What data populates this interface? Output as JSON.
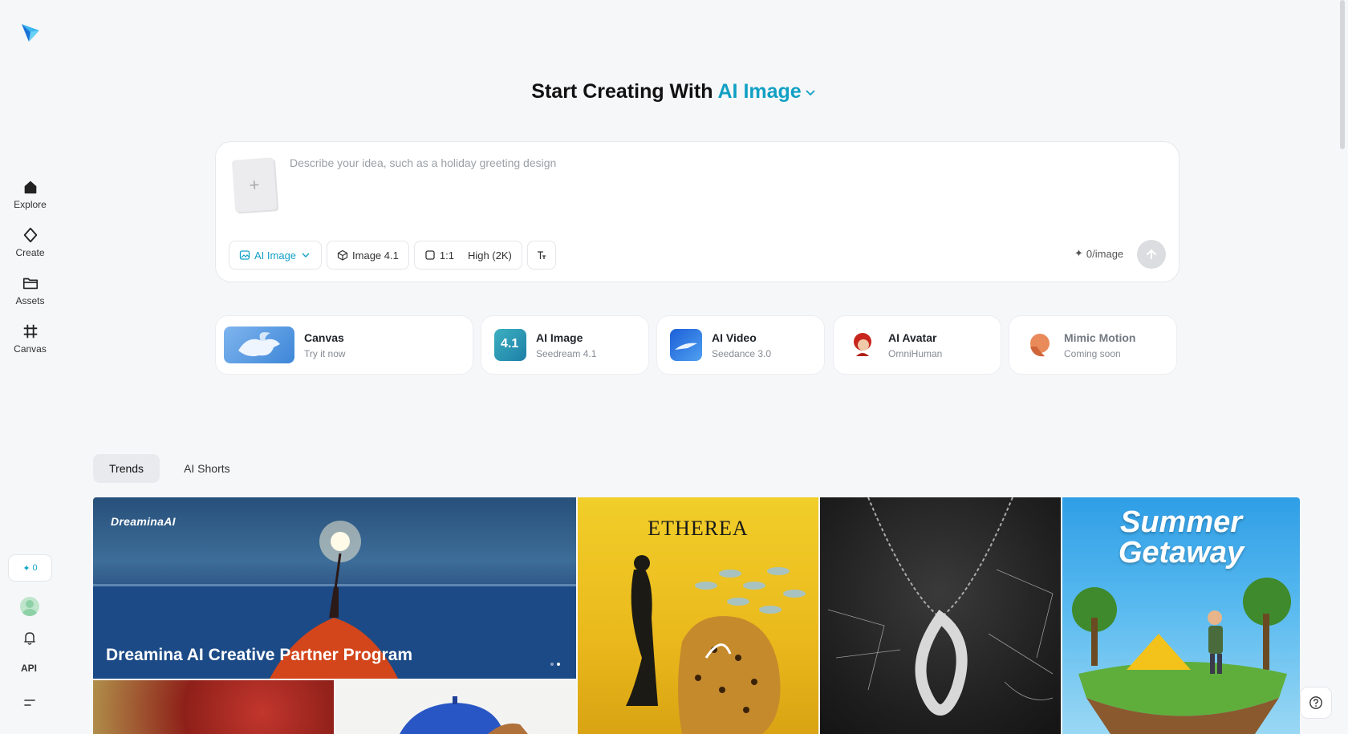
{
  "nav": {
    "items": [
      {
        "label": "Explore",
        "icon": "home-icon"
      },
      {
        "label": "Create",
        "icon": "sparkle-icon"
      },
      {
        "label": "Assets",
        "icon": "folder-icon"
      },
      {
        "label": "Canvas",
        "icon": "crop-icon"
      }
    ],
    "credits": "0",
    "api_label": "API"
  },
  "hero": {
    "prefix": "Start Creating With",
    "mode": "AI Image"
  },
  "prompt": {
    "placeholder": "Describe your idea, such as a holiday greeting design",
    "upload_symbol": "+",
    "chips": {
      "mode": "AI Image",
      "model": "Image 4.1",
      "ratio": "1:1",
      "quality": "High (2K)"
    },
    "cost": "0/image"
  },
  "tools": [
    {
      "title": "Canvas",
      "subtitle": "Try it now"
    },
    {
      "title": "AI Image",
      "subtitle": "Seedream 4.1",
      "badge": "4.1"
    },
    {
      "title": "AI Video",
      "subtitle": "Seedance 3.0"
    },
    {
      "title": "AI Avatar",
      "subtitle": "OmniHuman"
    },
    {
      "title": "Mimic Motion",
      "subtitle": "Coming soon"
    }
  ],
  "tabs": [
    {
      "label": "Trends",
      "active": true
    },
    {
      "label": "AI Shorts",
      "active": false
    }
  ],
  "gallery": {
    "banner": {
      "brand": "DreaminaAI",
      "title": "Dreamina AI Creative Partner Program"
    },
    "ethera": {
      "title": "ETHEREA"
    },
    "summer": {
      "title": "Summer Getaway"
    }
  },
  "colors": {
    "accent": "#11a0c4",
    "background": "#f6f7f9"
  }
}
